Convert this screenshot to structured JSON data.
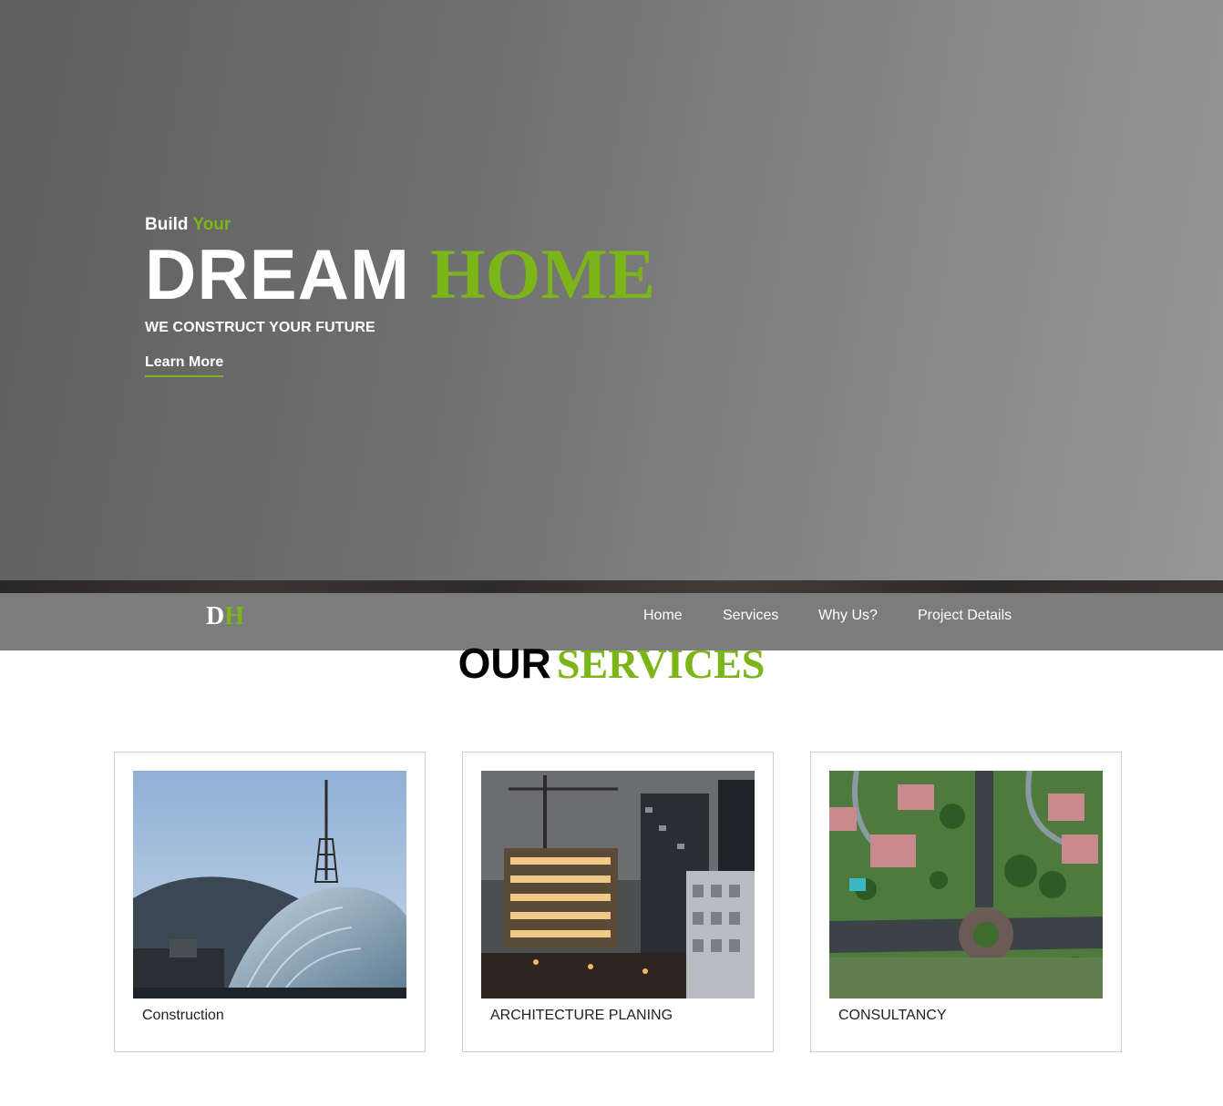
{
  "hero": {
    "kicker_part1": "Build",
    "kicker_part2": "Your",
    "title_part1": "DREAM",
    "title_part2": "HOME",
    "tagline": "WE CONSTRUCT YOUR FUTURE",
    "cta_label": "Learn More"
  },
  "navbar": {
    "logo_d": "D",
    "logo_h": "H",
    "items": [
      {
        "label": "Home"
      },
      {
        "label": "Services"
      },
      {
        "label": "Why Us?"
      },
      {
        "label": "Project Details"
      }
    ]
  },
  "services": {
    "title_part1": "OUR",
    "title_part2": "SERVICES",
    "cards": [
      {
        "label": "Construction",
        "image": "stadium-tower-photo"
      },
      {
        "label": "ARCHITECTURE PLANING",
        "image": "construction-site-night-photo"
      },
      {
        "label": "CONSULTANCY",
        "image": "aerial-neighborhood-photo"
      }
    ]
  },
  "colors": {
    "accent": "#7cb518",
    "navbar": "#7c7c7c",
    "hero_left": "#5f5f5f",
    "hero_right": "#979797"
  }
}
